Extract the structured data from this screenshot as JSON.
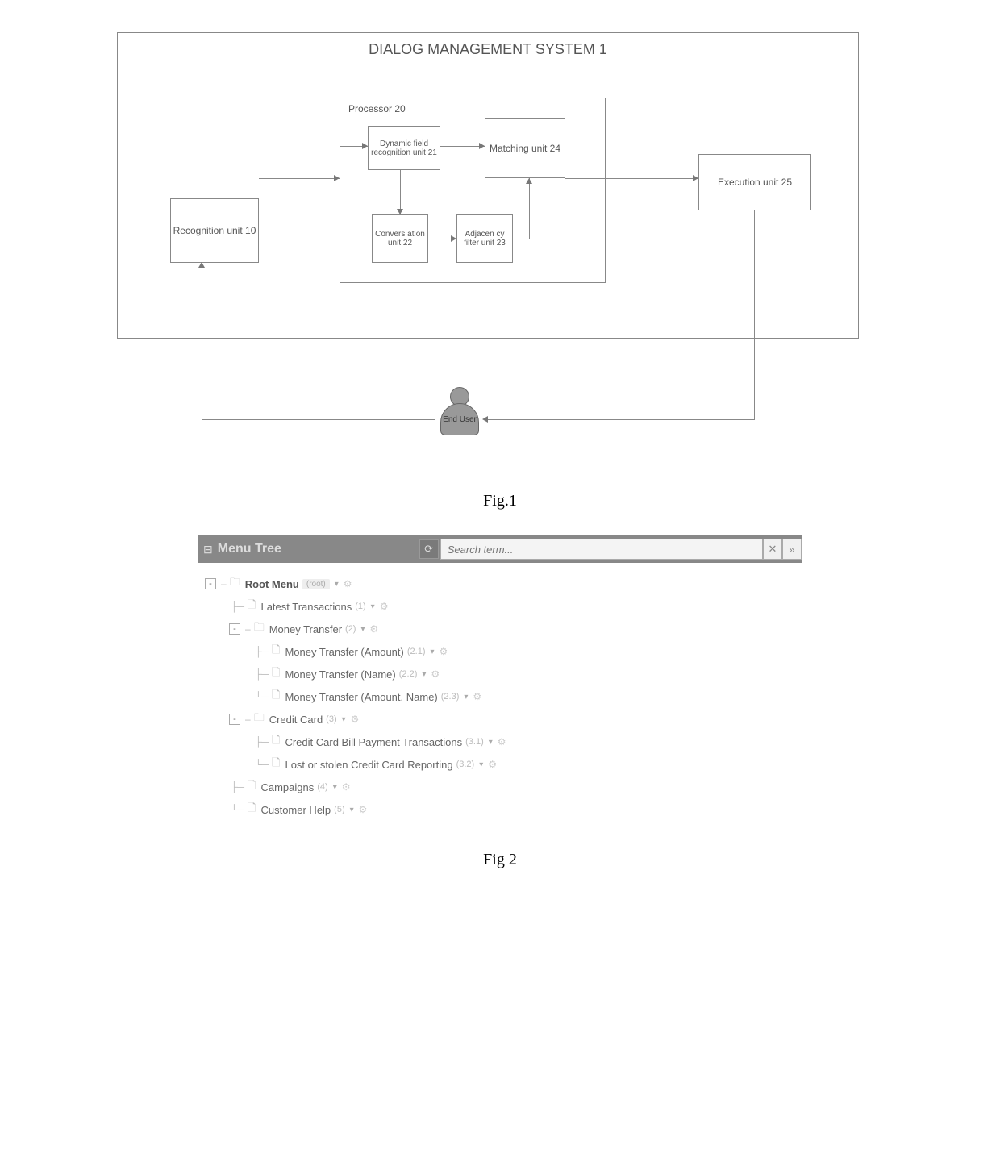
{
  "fig1": {
    "title": "DIALOG MANAGEMENT SYSTEM  1",
    "recognition": "Recognition unit  10",
    "processor": "Processor  20",
    "dynamic": "Dynamic field recognition unit  21",
    "conversation": "Convers ation unit  22",
    "adjacency": "Adjacen cy filter unit  23",
    "matching": "Matching unit  24",
    "execution": "Execution unit  25",
    "end_user": "End User",
    "caption": "Fig.1"
  },
  "menu": {
    "panel_title": "Menu Tree",
    "search_placeholder": "Search term...",
    "items": [
      {
        "label": "Root Menu",
        "id": "(root)",
        "type": "folder",
        "indent": 0,
        "toggle": "-",
        "bold": true,
        "root": true
      },
      {
        "label": "Latest Transactions",
        "id": "(1)",
        "type": "page",
        "indent": 1
      },
      {
        "label": "Money Transfer",
        "id": "(2)",
        "type": "folder",
        "indent": 1,
        "toggle": "-"
      },
      {
        "label": "Money Transfer (Amount)",
        "id": "(2.1)",
        "type": "page",
        "indent": 2
      },
      {
        "label": "Money Transfer (Name)",
        "id": "(2.2)",
        "type": "page",
        "indent": 2
      },
      {
        "label": "Money Transfer (Amount, Name)",
        "id": "(2.3)",
        "type": "page",
        "indent": 2,
        "last": true
      },
      {
        "label": "Credit Card",
        "id": "(3)",
        "type": "folder",
        "indent": 1,
        "toggle": "-"
      },
      {
        "label": "Credit Card Bill Payment Transactions",
        "id": "(3.1)",
        "type": "page",
        "indent": 2
      },
      {
        "label": "Lost or stolen Credit Card Reporting",
        "id": "(3.2)",
        "type": "page",
        "indent": 2,
        "last": true
      },
      {
        "label": "Campaigns",
        "id": "(4)",
        "type": "page",
        "indent": 1
      },
      {
        "label": "Customer Help",
        "id": "(5)",
        "type": "page",
        "indent": 1,
        "last": true
      }
    ],
    "caption": "Fig 2"
  },
  "chart_data": {
    "type": "diagram",
    "fig1_blocks": [
      {
        "id": "system",
        "label": "DIALOG MANAGEMENT SYSTEM 1",
        "contains": [
          "recognition_10",
          "processor_20",
          "execution_25"
        ]
      },
      {
        "id": "recognition_10",
        "label": "Recognition unit 10"
      },
      {
        "id": "processor_20",
        "label": "Processor 20",
        "contains": [
          "dynamic_21",
          "conversation_22",
          "adjacency_23",
          "matching_24"
        ]
      },
      {
        "id": "dynamic_21",
        "label": "Dynamic field recognition unit 21"
      },
      {
        "id": "conversation_22",
        "label": "Conversation unit 22"
      },
      {
        "id": "adjacency_23",
        "label": "Adjacency filter unit 23"
      },
      {
        "id": "matching_24",
        "label": "Matching unit 24"
      },
      {
        "id": "execution_25",
        "label": "Execution unit 25"
      },
      {
        "id": "end_user",
        "label": "End User"
      }
    ],
    "fig1_edges": [
      {
        "from": "recognition_10",
        "to": "processor_20"
      },
      {
        "from": "dynamic_21",
        "to": "matching_24"
      },
      {
        "from": "dynamic_21",
        "to": "conversation_22"
      },
      {
        "from": "conversation_22",
        "to": "adjacency_23"
      },
      {
        "from": "adjacency_23",
        "to": "matching_24"
      },
      {
        "from": "processor_20",
        "to": "execution_25"
      },
      {
        "from": "execution_25",
        "to": "end_user"
      },
      {
        "from": "end_user",
        "to": "recognition_10"
      }
    ],
    "fig2_tree": {
      "Root Menu (root)": {
        "Latest Transactions (1)": {},
        "Money Transfer (2)": {
          "Money Transfer (Amount) (2.1)": {},
          "Money Transfer (Name) (2.2)": {},
          "Money Transfer (Amount, Name) (2.3)": {}
        },
        "Credit Card (3)": {
          "Credit Card Bill Payment Transactions (3.1)": {},
          "Lost or stolen Credit Card Reporting (3.2)": {}
        },
        "Campaigns (4)": {},
        "Customer Help (5)": {}
      }
    }
  }
}
